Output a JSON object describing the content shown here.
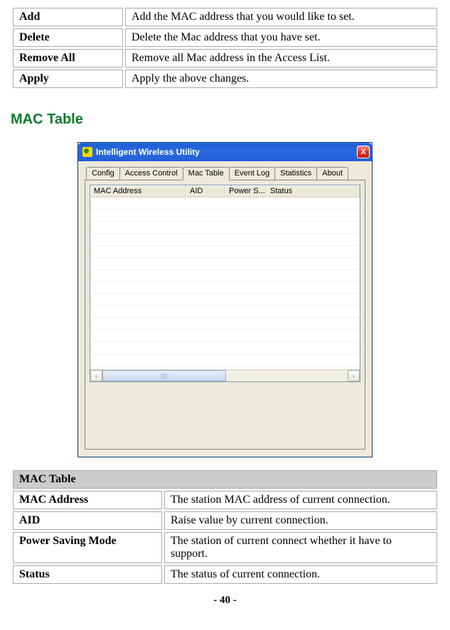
{
  "top_table": [
    {
      "term": "Add",
      "desc": "Add the MAC address that you would like to set."
    },
    {
      "term": "Delete",
      "desc": "Delete the Mac address that you have set."
    },
    {
      "term": "Remove All",
      "desc": "Remove all Mac address in the Access List."
    },
    {
      "term": "Apply",
      "desc": "Apply the above changes."
    }
  ],
  "section_heading": "MAC Table",
  "window": {
    "title": "Intelligent Wireless Utility",
    "close": "X",
    "tabs": [
      "Config",
      "Access Control",
      "Mac Table",
      "Event Log",
      "Statistics",
      "About"
    ],
    "active_tab_index": 2,
    "columns": [
      "MAC Address",
      "AID",
      "Power S...",
      "Status"
    ],
    "scroll_left": "‹",
    "scroll_right": "›",
    "thumb": "|||"
  },
  "mac_table": {
    "header": "MAC Table",
    "rows": [
      {
        "term": "MAC Address",
        "desc": "The station MAC address of current connection."
      },
      {
        "term": "AID",
        "desc": "Raise value by current connection."
      },
      {
        "term": "Power Saving Mode",
        "desc": "The station of current connect whether it have to support."
      },
      {
        "term": "Status",
        "desc": "The status of current connection."
      }
    ]
  },
  "page_number": "- 40 -"
}
